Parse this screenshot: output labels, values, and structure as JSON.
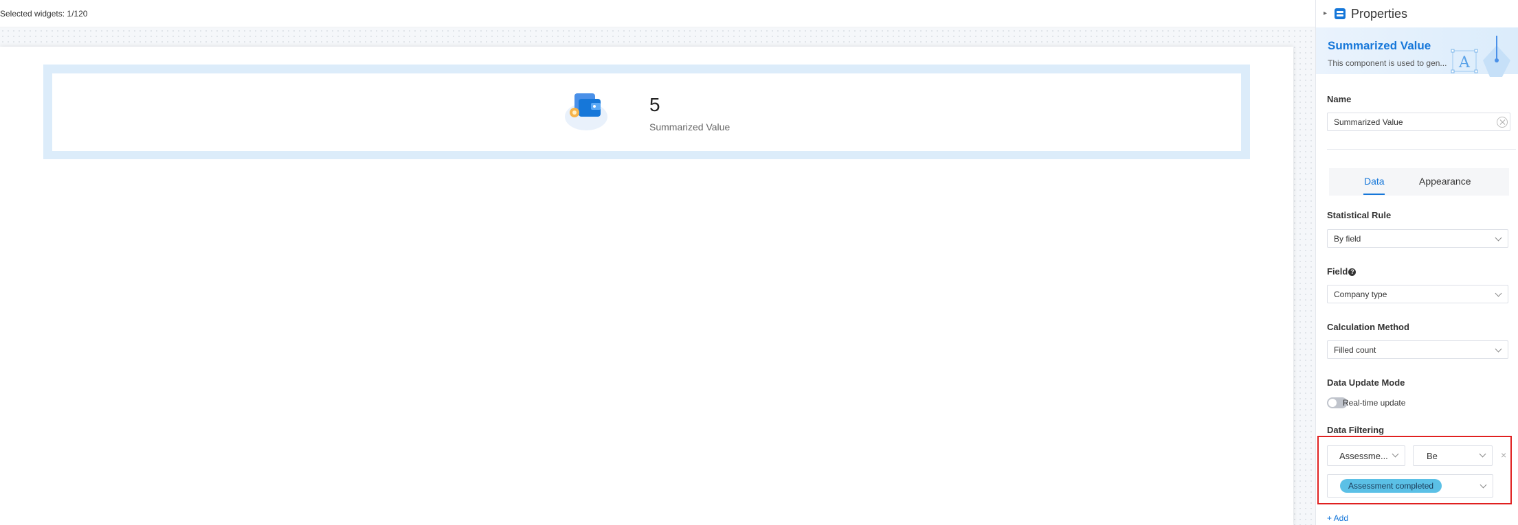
{
  "canvas": {
    "selected_widgets": "Selected widgets: 1/120",
    "widget": {
      "value": "5",
      "label": "Summarized Value"
    }
  },
  "panel": {
    "header": {
      "title": "Properties"
    },
    "banner": {
      "title": "Summarized Value",
      "description": "This component is used to gen..."
    },
    "name": {
      "label": "Name",
      "value": "Summarized Value"
    },
    "tabs": [
      {
        "label": "Data",
        "active": true
      },
      {
        "label": "Appearance",
        "active": false
      }
    ],
    "statistical_rule": {
      "label": "Statistical Rule",
      "value": "By field"
    },
    "field": {
      "label": "Field",
      "help": "?",
      "value": "Company type"
    },
    "calculation_method": {
      "label": "Calculation Method",
      "value": "Filled count"
    },
    "data_update_mode": {
      "label": "Data Update Mode",
      "toggle_label": "Real-time update",
      "enabled": false
    },
    "data_filtering": {
      "label": "Data Filtering",
      "field_value": "Assessme...",
      "operator_value": "Be",
      "values": [
        "Assessment completed"
      ],
      "close": "×"
    },
    "add_label": "+ Add"
  },
  "colors": {
    "accent": "#1677d9",
    "highlight_border": "#e02020",
    "tag": "#5bc0e6",
    "selection": "#dcecfa"
  },
  "icons": [
    "wallet-icon",
    "properties-icon",
    "clear-icon",
    "chevron-down-icon",
    "close-icon",
    "help-icon"
  ]
}
